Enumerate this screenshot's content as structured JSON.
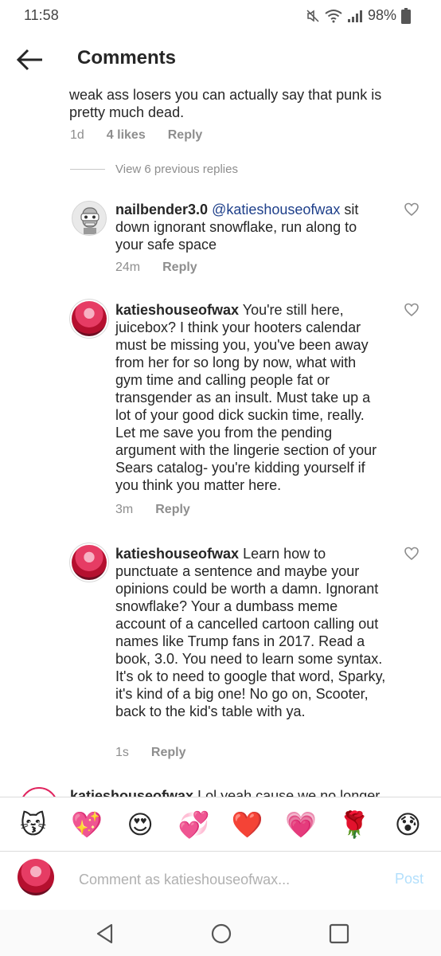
{
  "status_bar": {
    "time": "11:58",
    "battery": "98%"
  },
  "header": {
    "title": "Comments"
  },
  "top_comment": {
    "text": "weak ass losers you can actually say that punk is pretty much dead.",
    "age": "1d",
    "likes": "4 likes",
    "reply_label": "Reply"
  },
  "view_previous": {
    "label": "View 6 previous replies"
  },
  "replies": [
    {
      "username": "nailbender3.0",
      "mention": "@katieshouseofwax",
      "text": " sit down ignorant snowflake, run along to your safe space",
      "age": "24m",
      "reply_label": "Reply"
    },
    {
      "username": "katieshouseofwax",
      "text": " You're still here, juicebox? I think your hooters calendar must be missing you, you've been away from her for so long by now, what with gym time and calling people fat or transgender as an insult. Must take up a lot of your good dick suckin time, really. Let me save you from the pending argument with the lingerie section of your Sears catalog- you're kidding yourself if you think you matter here.",
      "age": "3m",
      "reply_label": "Reply"
    },
    {
      "username": "katieshouseofwax",
      "text": " Learn how to punctuate a sentence and maybe your opinions could be worth a damn. Ignorant snowflake? Your a dumbass meme account of a cancelled cartoon calling out names like Trump fans in 2017. Read a book, 3.0. You need to learn some syntax. It's ok to need to google that word, Sparky, it's kind of a big one! No go on, Scooter, back to the kid's table with ya.",
      "age": "1s",
      "reply_label": "Reply"
    }
  ],
  "partial_comment": {
    "username": "katieshouseofwax",
    "text": " Lol yeah cause we no longer"
  },
  "emoji_bar": [
    "😽",
    "💖",
    "😍",
    "💞",
    "❤️",
    "💗",
    "🌹",
    "😰"
  ],
  "comment_input": {
    "placeholder": "Comment as katieshouseofwax...",
    "post_label": "Post"
  },
  "colors": {
    "link": "#1e3f8a",
    "muted": "#8e8e8e",
    "post_disabled": "#b2dffc"
  }
}
